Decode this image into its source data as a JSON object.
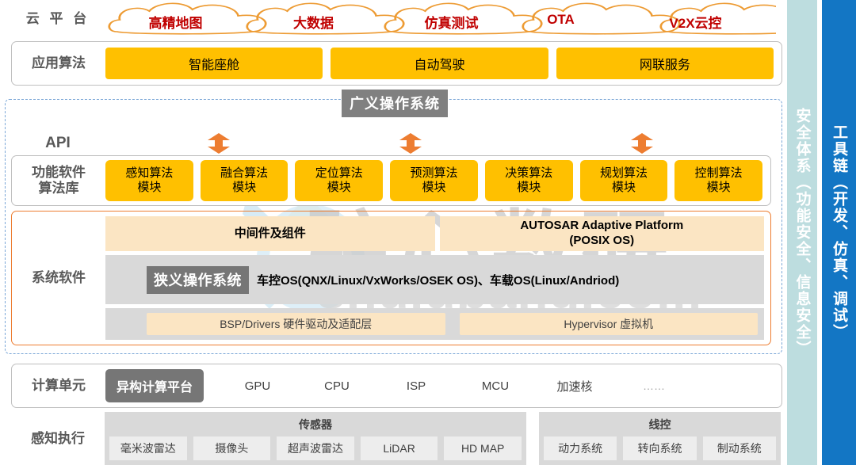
{
  "watermark": {
    "cn": "驻心数研",
    "url": "shujubang.com"
  },
  "cloud": {
    "label": "云 平 台",
    "items": [
      "高精地图",
      "大数据",
      "仿真测试",
      "OTA",
      "V2X云控"
    ],
    "text_color": "#c00000",
    "outline_color": "#ED9B33"
  },
  "application": {
    "label": "应用算法",
    "items": [
      "智能座舱",
      "自动驾驶",
      "网联服务"
    ],
    "box_color": "#FFC000"
  },
  "broad_os": {
    "badge": "广义操作系统",
    "badge_color": "#808080",
    "border_color": "#7ba7d7"
  },
  "api": {
    "label": "API"
  },
  "functional_software": {
    "label": "功能软件\n算法库",
    "label_line1": "功能软件",
    "label_line2": "算法库",
    "modules": [
      {
        "line1": "感知算法",
        "line2": "模块"
      },
      {
        "line1": "融合算法",
        "line2": "模块"
      },
      {
        "line1": "定位算法",
        "line2": "模块"
      },
      {
        "line1": "预测算法",
        "line2": "模块"
      },
      {
        "line1": "决策算法",
        "line2": "模块"
      },
      {
        "line1": "规划算法",
        "line2": "模块"
      },
      {
        "line1": "控制算法",
        "line2": "模块"
      }
    ],
    "module_color": "#FFC000"
  },
  "system_software": {
    "label": "系统软件",
    "border_color": "#ED7D31",
    "middleware": "中间件及组件",
    "autosar_line1": "AUTOSAR Adaptive Platform",
    "autosar_line2": "(POSIX OS)",
    "narrow_os_badge": "狭义操作系统",
    "narrow_os_badge_color": "#767676",
    "os_text": "车控OS(QNX/Linux/VxWorks/OSEK OS)、车载OS(Linux/Andriod)",
    "bsp": "BSP/Drivers 硬件驱动及适配层",
    "hypervisor": "Hypervisor 虚拟机"
  },
  "compute_unit": {
    "label": "计算单元",
    "badge": "异构计算平台",
    "badge_color": "#767676",
    "items": [
      "GPU",
      "CPU",
      "ISP",
      "MCU",
      "加速核",
      "……"
    ]
  },
  "perception": {
    "label": "感知执行",
    "groups": [
      {
        "title": "传感器",
        "items": [
          "毫米波雷达",
          "摄像头",
          "超声波雷达",
          "LiDAR",
          "HD MAP"
        ]
      },
      {
        "title": "线控",
        "items": [
          "动力系统",
          "转向系统",
          "制动系统"
        ]
      }
    ]
  },
  "side_bars": {
    "safety": {
      "text": "安全体系（功能安全、信息安全）",
      "color": "#BDDDDF"
    },
    "toolchain": {
      "text": "工具链（开发、仿真、调试）",
      "color": "#1376C4"
    }
  }
}
